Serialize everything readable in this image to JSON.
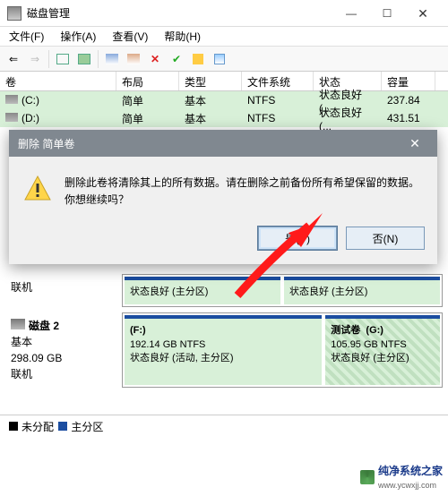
{
  "window": {
    "title": "磁盘管理"
  },
  "window_controls": {
    "min": "—",
    "max": "☐",
    "close": "✕"
  },
  "menu": {
    "file": "文件(F)",
    "action": "操作(A)",
    "view": "查看(V)",
    "help": "帮助(H)"
  },
  "columns": {
    "vol": "卷",
    "layout": "布局",
    "type": "类型",
    "fs": "文件系统",
    "status": "状态",
    "cap": "容量"
  },
  "rows": [
    {
      "vol": "(C:)",
      "layout": "简单",
      "type": "基本",
      "fs": "NTFS",
      "status": "状态良好 (...",
      "cap": "237.84"
    },
    {
      "vol": "(D:)",
      "layout": "简单",
      "type": "基本",
      "fs": "NTFS",
      "status": "状态良好 (...",
      "cap": "431.51"
    }
  ],
  "disk1": {
    "online": "联机",
    "p1": "状态良好 (主分区)",
    "p2": "状态良好 (主分区)"
  },
  "disk2": {
    "name": "磁盘 2",
    "type": "基本",
    "size": "298.09 GB",
    "online": "联机",
    "p1": {
      "letter": "(F:)",
      "info": "192.14 GB NTFS",
      "status": "状态良好 (活动, 主分区)"
    },
    "p2": {
      "label": "测试卷",
      "letter": "(G:)",
      "info": "105.95 GB NTFS",
      "status": "状态良好 (主分区)"
    }
  },
  "legend": {
    "unalloc": "未分配",
    "primary": "主分区"
  },
  "dialog": {
    "title": "删除 简单卷",
    "message": "删除此卷将清除其上的所有数据。请在删除之前备份所有希望保留的数据。你想继续吗？",
    "yes": "是(Y)",
    "no": "否(N)",
    "close": "✕"
  },
  "watermark": {
    "text": "纯净系统之家",
    "url": "www.ycwxjj.com"
  }
}
